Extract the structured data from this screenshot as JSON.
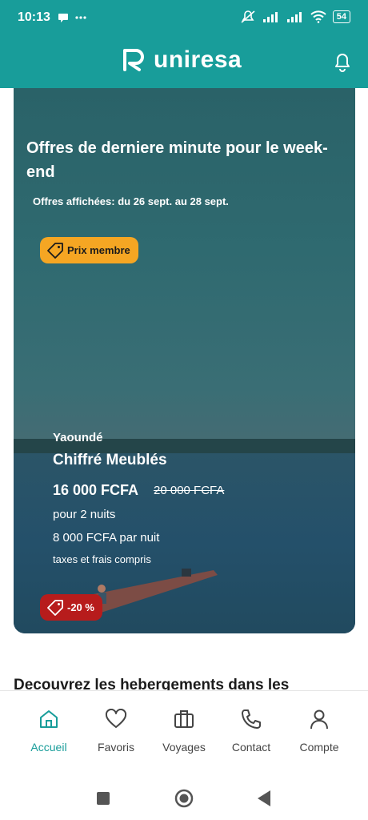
{
  "status": {
    "time": "10:13",
    "battery": "54"
  },
  "header": {
    "brand": "uniresa"
  },
  "hero": {
    "title": "Offres de derniere minute pour le week-end",
    "subtitle": "Offres affichées: du 26 sept. au 28 sept.",
    "member_badge": "Prix membre",
    "offer": {
      "city": "Yaoundé",
      "name": "Chiffré Meublés",
      "price": "16 000 FCFA",
      "old_price": "20 000 FCFA",
      "nights": "pour 2 nuits",
      "per_night": "8 000 FCFA par nuit",
      "taxes": "taxes et frais compris",
      "discount": "-20 %"
    }
  },
  "section": {
    "title": "Decouvrez les hebergements dans les"
  },
  "nav": [
    {
      "label": "Accueil",
      "icon": "home-icon",
      "active": true
    },
    {
      "label": "Favoris",
      "icon": "heart-icon",
      "active": false
    },
    {
      "label": "Voyages",
      "icon": "suitcase-icon",
      "active": false
    },
    {
      "label": "Contact",
      "icon": "phone-icon",
      "active": false
    },
    {
      "label": "Compte",
      "icon": "user-icon",
      "active": false
    }
  ],
  "colors": {
    "brand": "#189d9a",
    "member_badge": "#f5a623",
    "discount_badge": "#b71c1c"
  }
}
